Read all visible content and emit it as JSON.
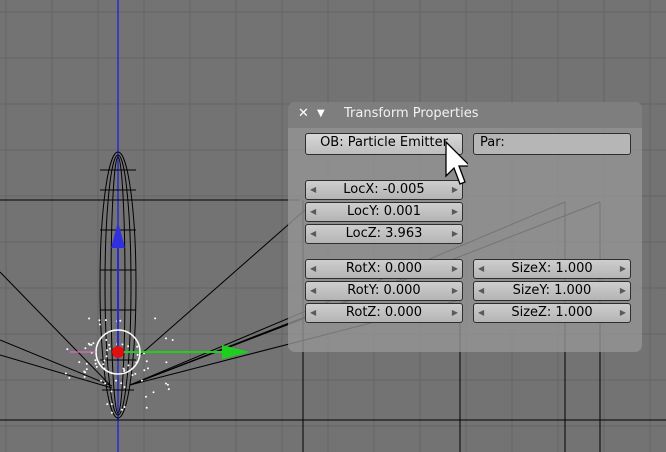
{
  "panel": {
    "title": "Transform Properties",
    "object_button": "OB: Particle Emitter",
    "parent_field": "Par:"
  },
  "location": [
    "LocX: -0.005",
    "LocY: 0.001",
    "LocZ: 3.963"
  ],
  "rotation": [
    "RotX: 0.000",
    "RotY: 0.000",
    "RotZ: 0.000"
  ],
  "size": [
    "SizeX: 1.000",
    "SizeY: 1.000",
    "SizeZ: 1.000"
  ],
  "icons": {
    "close": "close-icon",
    "collapse": "triangle-down-icon",
    "arrow_left": "arrow-left-icon",
    "arrow_right": "arrow-right-icon"
  },
  "colors": {
    "viewport": "#737373",
    "grid": "#666666",
    "x_axis": "#1fcf1f",
    "y_axis": "#3030e0",
    "origin": "#e01010"
  }
}
